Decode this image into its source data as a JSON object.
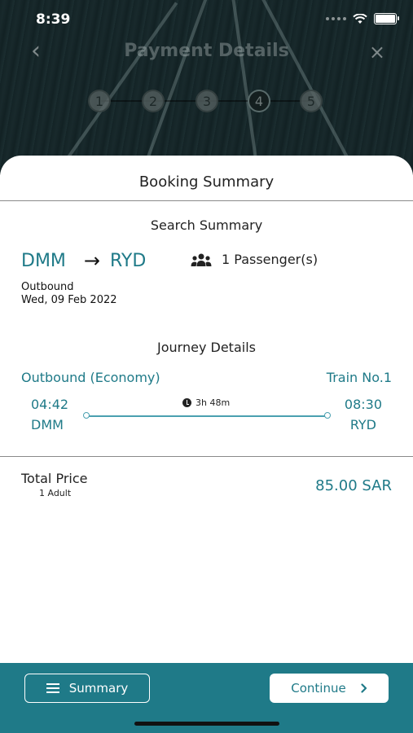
{
  "status_bar": {
    "time": "8:39"
  },
  "header": {
    "title": "Payment Details",
    "back_icon": "chevron-left-icon",
    "close_icon": "close-icon"
  },
  "stepper": {
    "steps": [
      "1",
      "2",
      "3",
      "4",
      "5"
    ],
    "active_step": 4
  },
  "sheet": {
    "title": "Booking Summary",
    "search_summary": {
      "title": "Search Summary",
      "from": "DMM",
      "to": "RYD",
      "passengers": "1 Passenger(s)",
      "direction": "Outbound",
      "date": "Wed, 09 Feb 2022"
    },
    "journey": {
      "title": "Journey Details",
      "class_label": "Outbound (Economy)",
      "train": "Train No.1",
      "depart_time": "04:42",
      "depart_station": "DMM",
      "arrive_time": "08:30",
      "arrive_station": "RYD",
      "duration": "3h 48m"
    },
    "total": {
      "label": "Total Price",
      "sub": "1 Adult",
      "price": "85.00 SAR"
    }
  },
  "bottom_bar": {
    "summary_label": "Summary",
    "continue_label": "Continue"
  },
  "colors": {
    "accent": "#1f7a88",
    "timeline": "#4aa0b0"
  }
}
